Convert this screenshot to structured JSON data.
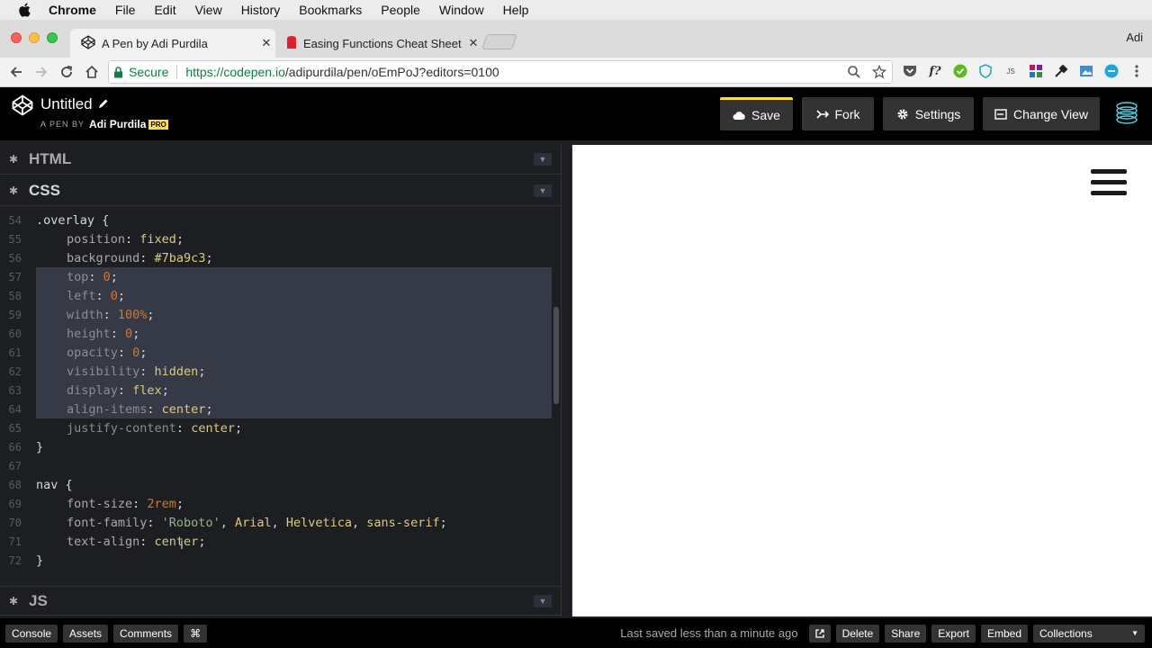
{
  "menubar": {
    "app": "Chrome",
    "items": [
      "File",
      "Edit",
      "View",
      "History",
      "Bookmarks",
      "People",
      "Window",
      "Help"
    ]
  },
  "tabs": [
    {
      "title": "A Pen by Adi Purdila",
      "close": "✕",
      "active": true,
      "icon": "codepen-icon"
    },
    {
      "title": "Easing Functions Cheat Sheet",
      "close": "✕",
      "active": false,
      "icon": "easings-icon"
    }
  ],
  "profile": "Adi",
  "address": {
    "secure_label": "Secure",
    "url_host": "https://codepen.io",
    "url_path": "/adipurdila/pen/oEmPoJ?editors=0100"
  },
  "extensions": {
    "fx_label": "f?",
    "js_label": "JS"
  },
  "pen": {
    "title": "Untitled",
    "by_label": "A PEN BY",
    "author": "Adi Purdila",
    "badge": "PRO"
  },
  "header_buttons": {
    "save": "Save",
    "fork": "Fork",
    "settings": "Settings",
    "change_view": "Change View"
  },
  "panels": {
    "html": "HTML",
    "css": "CSS",
    "js": "JS"
  },
  "code_lines": [
    {
      "n": "54",
      "tokens": [
        {
          "t": ".overlay {",
          "c": "c-sel"
        }
      ]
    },
    {
      "n": "55",
      "indent": true,
      "tokens": [
        {
          "t": "position",
          "c": "c-prop"
        },
        {
          "t": ": ",
          "c": "c-pun"
        },
        {
          "t": "fixed",
          "c": "c-val"
        },
        {
          "t": ";",
          "c": "c-pun"
        }
      ]
    },
    {
      "n": "56",
      "indent": true,
      "tokens": [
        {
          "t": "background",
          "c": "c-prop"
        },
        {
          "t": ": ",
          "c": "c-pun"
        },
        {
          "t": "#7ba9c3",
          "c": "c-hex"
        },
        {
          "t": ";",
          "c": "c-pun"
        }
      ]
    },
    {
      "n": "57",
      "indent": true,
      "tokens": [
        {
          "t": "top",
          "c": "c-prop dim"
        },
        {
          "t": ": ",
          "c": "c-pun"
        },
        {
          "t": "0",
          "c": "c-num"
        },
        {
          "t": ";",
          "c": "c-pun"
        }
      ]
    },
    {
      "n": "58",
      "indent": true,
      "tokens": [
        {
          "t": "left",
          "c": "c-prop dim"
        },
        {
          "t": ": ",
          "c": "c-pun"
        },
        {
          "t": "0",
          "c": "c-num"
        },
        {
          "t": ";",
          "c": "c-pun"
        }
      ]
    },
    {
      "n": "59",
      "indent": true,
      "tokens": [
        {
          "t": "width",
          "c": "c-prop dim"
        },
        {
          "t": ": ",
          "c": "c-pun"
        },
        {
          "t": "100%",
          "c": "c-num"
        },
        {
          "t": ";",
          "c": "c-pun"
        }
      ]
    },
    {
      "n": "60",
      "indent": true,
      "tokens": [
        {
          "t": "height",
          "c": "c-prop dim"
        },
        {
          "t": ": ",
          "c": "c-pun"
        },
        {
          "t": "0",
          "c": "c-num"
        },
        {
          "t": ";",
          "c": "c-pun"
        }
      ]
    },
    {
      "n": "61",
      "indent": true,
      "tokens": [
        {
          "t": "opacity",
          "c": "c-prop dim"
        },
        {
          "t": ": ",
          "c": "c-pun"
        },
        {
          "t": "0",
          "c": "c-num"
        },
        {
          "t": ";",
          "c": "c-pun"
        }
      ]
    },
    {
      "n": "62",
      "indent": true,
      "tokens": [
        {
          "t": "visibility",
          "c": "c-prop dim"
        },
        {
          "t": ": ",
          "c": "c-pun"
        },
        {
          "t": "hidden",
          "c": "c-val"
        },
        {
          "t": ";",
          "c": "c-pun"
        }
      ]
    },
    {
      "n": "63",
      "indent": true,
      "tokens": [
        {
          "t": "display",
          "c": "c-prop dim"
        },
        {
          "t": ": ",
          "c": "c-pun"
        },
        {
          "t": "flex",
          "c": "c-val"
        },
        {
          "t": ";",
          "c": "c-pun"
        }
      ]
    },
    {
      "n": "64",
      "indent": true,
      "tokens": [
        {
          "t": "align-items",
          "c": "c-prop dim"
        },
        {
          "t": ": ",
          "c": "c-pun"
        },
        {
          "t": "center",
          "c": "c-val"
        },
        {
          "t": ";",
          "c": "c-pun"
        }
      ]
    },
    {
      "n": "65",
      "indent": true,
      "tokens": [
        {
          "t": "justify-content",
          "c": "c-prop dim"
        },
        {
          "t": ": ",
          "c": "c-pun"
        },
        {
          "t": "center",
          "c": "c-val"
        },
        {
          "t": ";",
          "c": "c-pun"
        }
      ]
    },
    {
      "n": "66",
      "tokens": [
        {
          "t": "}",
          "c": "c-sel"
        }
      ]
    },
    {
      "n": "67",
      "tokens": []
    },
    {
      "n": "68",
      "tokens": [
        {
          "t": "nav {",
          "c": "c-sel"
        }
      ]
    },
    {
      "n": "69",
      "indent": true,
      "tokens": [
        {
          "t": "font-size",
          "c": "c-prop"
        },
        {
          "t": ": ",
          "c": "c-pun"
        },
        {
          "t": "2rem",
          "c": "c-num"
        },
        {
          "t": ";",
          "c": "c-pun"
        }
      ]
    },
    {
      "n": "70",
      "indent": true,
      "tokens": [
        {
          "t": "font-family",
          "c": "c-prop"
        },
        {
          "t": ": ",
          "c": "c-pun"
        },
        {
          "t": "'Roboto'",
          "c": "c-str"
        },
        {
          "t": ", ",
          "c": "c-pun"
        },
        {
          "t": "Arial",
          "c": "c-val"
        },
        {
          "t": ", ",
          "c": "c-pun"
        },
        {
          "t": "Helvetica",
          "c": "c-val"
        },
        {
          "t": ", ",
          "c": "c-pun"
        },
        {
          "t": "sans-serif",
          "c": "c-val"
        },
        {
          "t": ";",
          "c": "c-pun"
        }
      ]
    },
    {
      "n": "71",
      "indent": true,
      "tokens": [
        {
          "t": "text-align",
          "c": "c-prop"
        },
        {
          "t": ": ",
          "c": "c-pun"
        },
        {
          "t": "center",
          "c": "c-val"
        },
        {
          "t": ";",
          "c": "c-pun"
        }
      ]
    },
    {
      "n": "72",
      "tokens": [
        {
          "t": "}",
          "c": "c-sel"
        }
      ]
    }
  ],
  "footer": {
    "left_buttons": [
      "Console",
      "Assets",
      "Comments",
      "⌘"
    ],
    "saved_status": "Last saved less than a minute ago",
    "right_buttons": [
      "Delete",
      "Share",
      "Export",
      "Embed",
      "Collections"
    ]
  },
  "colors": {
    "codepen_yellow": "#ffdd40",
    "selection": "#363a46",
    "secure_green": "#0b8043"
  }
}
